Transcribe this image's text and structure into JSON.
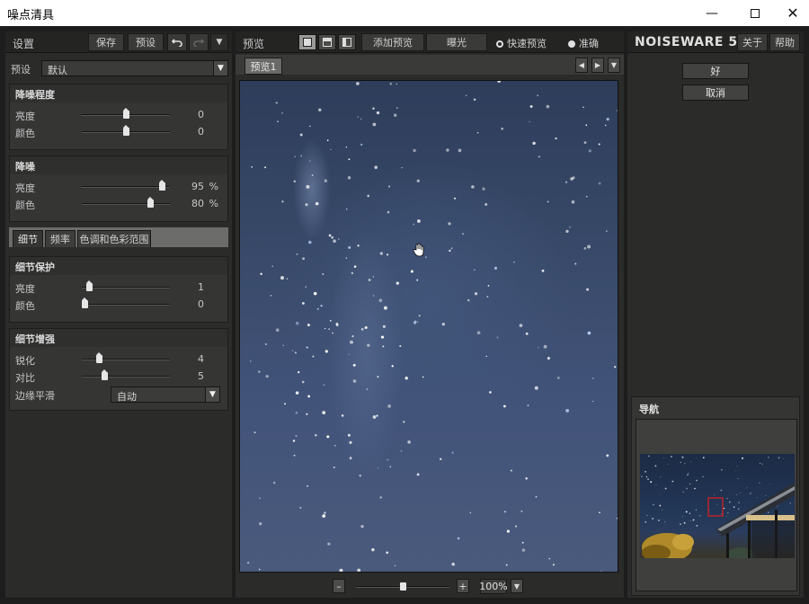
{
  "window": {
    "title": "噪点清具",
    "min_icon": "minimize-icon",
    "max_icon": "maximize-icon",
    "close_icon": "close-icon"
  },
  "left": {
    "toolbar": {
      "title": "设置",
      "save": "保存",
      "presets": "预设",
      "undo_icon": "undo-icon",
      "redo_icon": "redo-icon",
      "menu_icon": "dropdown-arrow-icon"
    },
    "preset": {
      "label": "预设",
      "value": "默认"
    },
    "noise_level": {
      "title": "降噪程度",
      "rows": [
        {
          "name": "亮度",
          "value": "0",
          "position": 0.5
        },
        {
          "name": "颜色",
          "value": "0",
          "position": 0.5
        }
      ]
    },
    "noise_reduction": {
      "title": "降噪",
      "rows": [
        {
          "name": "亮度",
          "value": "95",
          "unit": "%",
          "position": 0.95
        },
        {
          "name": "颜色",
          "value": "80",
          "unit": "%",
          "position": 0.8
        }
      ]
    },
    "tabs": [
      "细节",
      "频率",
      "色调和色彩范围"
    ],
    "detail_protection": {
      "title": "细节保护",
      "rows": [
        {
          "name": "亮度",
          "value": "1",
          "position": 0.05
        },
        {
          "name": "颜色",
          "value": "0",
          "position": 0.0
        }
      ]
    },
    "detail_enhance": {
      "title": "细节增强",
      "rows": [
        {
          "name": "锐化",
          "value": "4",
          "position": 0.18
        },
        {
          "name": "对比",
          "value": "5",
          "position": 0.24
        }
      ],
      "edge_label": "边缘平滑",
      "edge_value": "自动"
    }
  },
  "center": {
    "toolbar": {
      "title": "预览",
      "add_preview": "添加预览",
      "exposure": "曝光",
      "fast_preview": "快速预览",
      "accurate": "准确"
    },
    "preview_tab": "预览1",
    "zoom": "100%",
    "zoom_position": 0.5,
    "cursor_icon": "hand-cursor-icon"
  },
  "right": {
    "brand": "NOISEWARE 5",
    "about": "关于",
    "help": "帮助",
    "ok": "好",
    "cancel": "取消",
    "navigator": {
      "title": "导航"
    }
  }
}
